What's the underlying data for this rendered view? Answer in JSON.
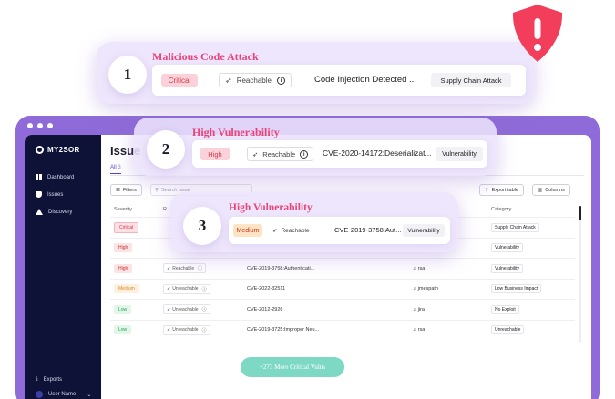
{
  "alert_cards": [
    {
      "index": "1",
      "title": "Malicious Code Attack",
      "severity": "Critical",
      "reachability": "Reachable",
      "description": "Code Injection Detected ...",
      "category": "Supply Chain Attack"
    },
    {
      "index": "2",
      "title": "High Vulnerability",
      "severity": "High",
      "reachability": "Reachable",
      "description": "CVE-2020-14172:Deserializat...",
      "category": "Vulnerability"
    },
    {
      "index": "3",
      "title": "High Vulnerability",
      "severity": "Medium",
      "reachability": "Reachable",
      "description": "CVE-2019-3758:Aut...",
      "category": "Vulnerability"
    }
  ],
  "sidebar": {
    "brand": "MY2SOR",
    "items": [
      {
        "label": "Dashboard",
        "icon": "grid-icon"
      },
      {
        "label": "Issues",
        "icon": "shield-icon"
      },
      {
        "label": "Discovery",
        "icon": "warning-icon"
      }
    ],
    "exports_label": "Exports",
    "user_label": "User Name"
  },
  "main": {
    "title": "Issue",
    "tab_all": "All",
    "tab_count": "3",
    "filters_label": "Filters",
    "search_placeholder": "Search issue",
    "export_label": "Export table",
    "columns_label": "Columns",
    "headers": {
      "severity": "Severity",
      "reach": "R",
      "category": "Category"
    }
  },
  "table_rows": [
    {
      "severity": "Critical",
      "reach": "",
      "title": "",
      "package": "",
      "category": "Supply Chain Attack"
    },
    {
      "severity": "High",
      "reach": "",
      "title": "",
      "package": "",
      "category": "Vulnerability"
    },
    {
      "severity": "High",
      "reach": "Reachable",
      "title": "CVE-2019-3758:Authenticati...",
      "package": "rsa",
      "category": "Vulnerability"
    },
    {
      "severity": "Medium",
      "reach": "Unreachable",
      "title": "CVE-2022-32511",
      "package": "jmespath",
      "category": "Low Business Impact"
    },
    {
      "severity": "Low",
      "reach": "Unreachable",
      "title": "CVE-2012-2926",
      "package": "jira",
      "category": "No Exploit"
    },
    {
      "severity": "Low",
      "reach": "Unreachable",
      "title": "CVE-2019-3725:Improper Neu...",
      "package": "rsa",
      "category": "Unreachable"
    }
  ],
  "more_button": "+273 More Critical Vulns",
  "colors": {
    "accent": "#8e6bd8",
    "sidebar": "#0e1236",
    "title_pink": "#e8457a",
    "shield": "#f33e5b",
    "more_button": "#7dd8c4"
  }
}
